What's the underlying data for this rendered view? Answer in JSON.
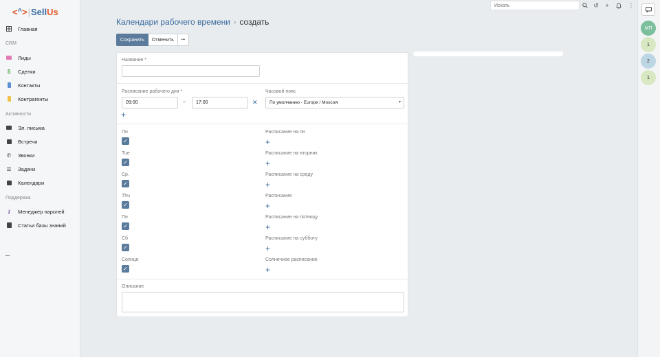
{
  "logo": {
    "left": "<",
    "arrow": "^",
    "right": ">",
    "bar": "|",
    "sell": "Sell",
    "us": "Us"
  },
  "sidebar": {
    "items": [
      {
        "label": "Главная",
        "icon": "grid-icon"
      },
      {
        "label": "Лиды",
        "icon": "id-card-icon"
      },
      {
        "label": "Сделки",
        "icon": "dollar-icon"
      },
      {
        "label": "Контакты",
        "icon": "contact-book-icon"
      },
      {
        "label": "Контрагенты",
        "icon": "bookmark-icon"
      },
      {
        "label": "Эл. письма",
        "icon": "envelope-icon"
      },
      {
        "label": "Встречи",
        "icon": "calendar-icon"
      },
      {
        "label": "Звонки",
        "icon": "phone-icon"
      },
      {
        "label": "Задачи",
        "icon": "tasks-icon"
      },
      {
        "label": "Календари",
        "icon": "calendar-icon"
      },
      {
        "label": "Менеджер паролей",
        "icon": "key-icon"
      },
      {
        "label": "Статьи базы знаний",
        "icon": "book-icon"
      }
    ],
    "sections": {
      "crm": "CRM",
      "activities": "Активности",
      "support": "Поддержка"
    },
    "more": "..."
  },
  "topbar": {
    "search_placeholder": "Искать"
  },
  "right_panel": {
    "avatar": "МП",
    "badge1": "1",
    "badge2": "2",
    "badge3": "1"
  },
  "breadcrumb": {
    "parent": "Календари рабочего времени",
    "sep": "›",
    "current": "создать"
  },
  "actions": {
    "save": "Сохранить",
    "cancel": "Отменить",
    "more": "•••"
  },
  "form": {
    "name_label": "Название *",
    "name_value": "",
    "schedule_label": "Расписание рабочего дня *",
    "time_from": "09:00",
    "time_dash": "–",
    "time_to": "17:00",
    "remove": "✕",
    "timezone_label": "Часовой пояс",
    "timezone_value": "По умолчанию - Europe / Moscow",
    "days": [
      {
        "day": "Пн",
        "schedule": "Расписание на пн"
      },
      {
        "day": "Tue",
        "schedule": "Расписание на вторник"
      },
      {
        "day": "Ср.",
        "schedule": "Расписание на среду"
      },
      {
        "day": "Thu",
        "schedule": "Расписание"
      },
      {
        "day": "Пн",
        "schedule": "Расписание на пятницу"
      },
      {
        "day": "Сб",
        "schedule": "Расписание на субботу"
      },
      {
        "day": "Солнце",
        "schedule": "Солнечное расписание"
      }
    ],
    "description_label": "Описание"
  },
  "colors": {
    "accent": "#5b7b9c",
    "link": "#3a6a9c",
    "brand_orange": "#e25b2b"
  }
}
